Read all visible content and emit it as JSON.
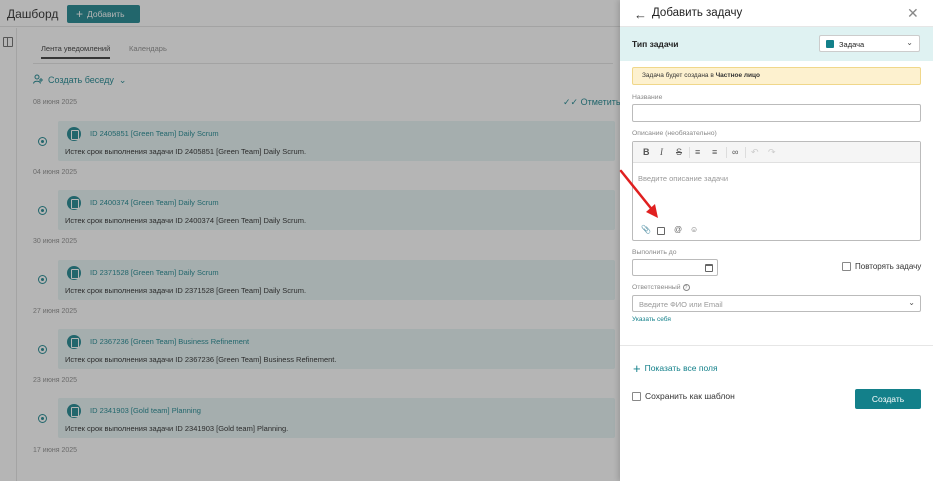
{
  "dashboard": {
    "title": "Дашборд",
    "add_button": "Добавить",
    "tabs": [
      {
        "label": "Лента уведомлений",
        "active": true
      },
      {
        "label": "Календарь",
        "active": false
      }
    ],
    "create_conversation": "Создать беседу",
    "mark_read": "Отметить",
    "feed": [
      {
        "date": "08 июня 2025",
        "title": "ID 2405851 [Green Team] Daily Scrum",
        "text": "Истек срок выполнения задачи ID 2405851 [Green Team] Daily Scrum."
      },
      {
        "date": "04 июня 2025",
        "title": "ID 2400374 [Green Team] Daily Scrum",
        "text": "Истек срок выполнения задачи ID 2400374 [Green Team] Daily Scrum."
      },
      {
        "date": "30 июня 2025",
        "title": "ID 2371528 [Green Team] Daily Scrum",
        "text": "Истек срок выполнения задачи ID 2371528 [Green Team] Daily Scrum."
      },
      {
        "date": "27 июня 2025",
        "title": "ID 2367236 [Green Team] Business Refinement",
        "text": "Истек срок выполнения задачи ID 2367236 [Green Team] Business Refinement."
      },
      {
        "date": "23 июня 2025",
        "title": "ID 2341903 [Gold team] Planning",
        "text": "Истек срок выполнения задачи ID 2341903 [Gold team] Planning."
      },
      {
        "date": "17 июня 2025",
        "title": "",
        "text": ""
      }
    ]
  },
  "panel": {
    "title": "Добавить задачу",
    "task_type_label": "Тип задачи",
    "task_type_value": "Задача",
    "warning_prefix": "Задача будет создана в ",
    "warning_bold": "Частное лицо",
    "name_label": "Название",
    "name_value": "",
    "description_label": "Описание (необязательно)",
    "description_placeholder": "Введите описание задачи",
    "due_label": "Выполнить до",
    "due_value": "",
    "repeat_label": "Повторять задачу",
    "responsible_label": "Ответственный",
    "responsible_placeholder": "Введите ФИО или Email",
    "assign_self": "Указать себя",
    "show_all_fields": "Показать все поля",
    "save_as_template": "Сохранить как шаблон",
    "create_button": "Создать"
  },
  "colors": {
    "accent": "#13808a",
    "notification_bg": "#e5f4f4",
    "task_type_bg": "#dff2f2",
    "warning_bg": "#fdf1cf",
    "annotation_arrow": "#e02020"
  }
}
